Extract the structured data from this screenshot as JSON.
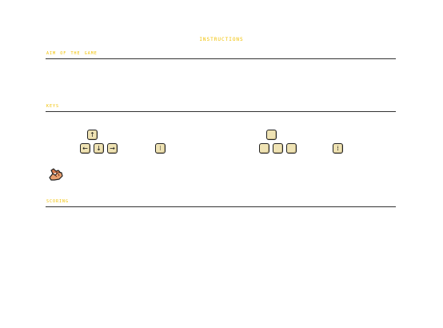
{
  "header": {
    "title": "INSTRUCTIONS"
  },
  "sections": {
    "aim": {
      "heading": "AIM OF THE GAME"
    },
    "keys": {
      "heading": "KEYS"
    },
    "scoring": {
      "heading": "SCORING"
    }
  },
  "keys": {
    "player1": {
      "up": "↑",
      "left": "←",
      "down": "↓",
      "right": "→",
      "action": "⁝"
    },
    "player2": {
      "up": "",
      "left": "",
      "down": "",
      "right": "",
      "action": "⁞"
    }
  },
  "icons": {
    "hand": "hand-icon"
  },
  "colors": {
    "heading": "#f0c000",
    "key_face": "#efe3b4",
    "rule": "#333333",
    "background": "#ffffff"
  }
}
